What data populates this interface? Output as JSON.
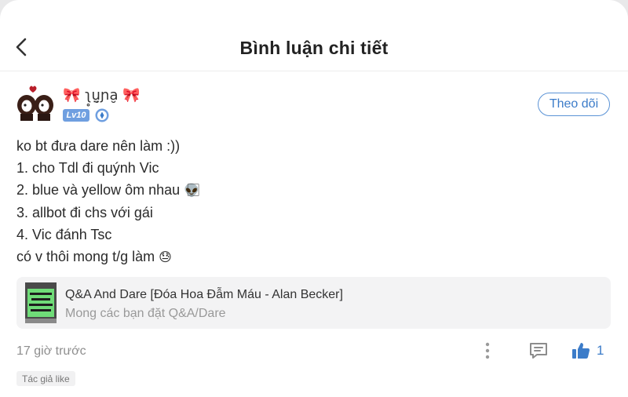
{
  "header": {
    "title": "Bình luận chi tiết",
    "back_icon": "chevron-left-icon"
  },
  "user": {
    "name": "🎀 ʅ̥ṳ̮ɲa̮ 🎀",
    "level": "Lv10",
    "follow_label": "Theo dõi",
    "avatar_icon": "couple-avatar-icon",
    "verify_icon": "verified-badge-icon"
  },
  "comment": {
    "lines": [
      "ko bt đưa dare nên làm :))",
      "1. cho Tdl đi quýnh Vic",
      "2. blue và yellow ôm nhau",
      "3. allbot đi chs với gái",
      "4. Vic đánh Tsc",
      "có v thôi mong t/g làm"
    ],
    "emoji_line2": "👽⃞",
    "emoji_line5": "😓"
  },
  "story": {
    "title": "Q&A And Dare [Đóa Hoa Đẫm Máu - Alan Becker]",
    "description": "Mong các bạn đặt Q&A/Dare",
    "cover_icon": "story-cover-image"
  },
  "meta": {
    "timestamp": "17 giờ trước",
    "like_count": "1",
    "author_like": "Tác giả like",
    "more_icon": "more-vertical-icon",
    "reply_icon": "comment-reply-icon",
    "like_icon": "thumbs-up-icon"
  },
  "colors": {
    "accent": "#3c7cc9",
    "badge": "#6f9fe0",
    "card_bg": "#f3f3f4"
  }
}
